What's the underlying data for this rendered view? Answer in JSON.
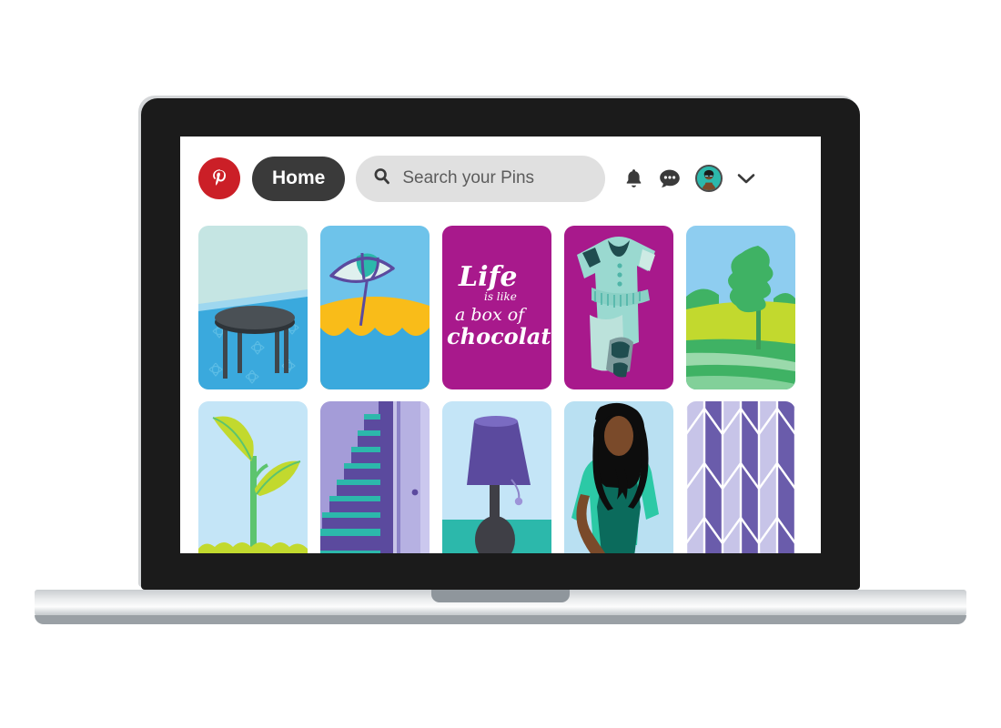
{
  "device": {
    "type": "laptop",
    "lid_color": "#1b1b1b",
    "base_color": "#d9dde0"
  },
  "app": {
    "name": "Pinterest",
    "brand_color": "#cb1f27"
  },
  "header": {
    "logo_icon": "pinterest-logo-icon",
    "home_label": "Home",
    "search": {
      "icon": "search-icon",
      "placeholder": "Search your Pins",
      "value": ""
    },
    "actions": [
      {
        "icon": "bell-icon",
        "label": "Notifications"
      },
      {
        "icon": "message-bubble-icon",
        "label": "Messages"
      },
      {
        "icon": "avatar-icon",
        "label": "Account"
      },
      {
        "icon": "chevron-down-icon",
        "label": "Account menu"
      }
    ]
  },
  "grid": {
    "pins": [
      {
        "id": "pin-1",
        "title": "Round dining table on blue patterned rug",
        "bg": "#3aa9dd"
      },
      {
        "id": "pin-2",
        "title": "Beach umbrella on sand by the sea",
        "bg": "#6ec3ea"
      },
      {
        "id": "pin-3",
        "title": "Life is like a box of chocolates quote",
        "bg": "#a8198c",
        "quote_lines": [
          "Life",
          "is like",
          "a box of",
          "chocolates"
        ]
      },
      {
        "id": "pin-4",
        "title": "Mint green baby romper dress",
        "bg": "#a8198c"
      },
      {
        "id": "pin-5",
        "title": "Tree in a green countryside field",
        "bg": "#8ecdf0"
      },
      {
        "id": "pin-6",
        "title": "Young green seedling sprout",
        "bg": "#c4e5f7"
      },
      {
        "id": "pin-7",
        "title": "Purple staircase beside a door",
        "bg": "#9a93d4"
      },
      {
        "id": "pin-8",
        "title": "Purple table lamp on teal surface",
        "bg": "#c4e5f7"
      },
      {
        "id": "pin-9",
        "title": "Woman in teal top with long hair",
        "bg": "#b9e0f2"
      },
      {
        "id": "pin-10",
        "title": "Purple herringbone chevron pattern",
        "bg": "#6a5cab"
      }
    ]
  },
  "palette": {
    "pinterest_red": "#cb1f27",
    "home_dark": "#3a3a3a",
    "search_grey": "#e0e0e0",
    "magenta": "#a8198c",
    "teal": "#2cb8ab",
    "purple": "#6a5cab",
    "lilac": "#c7c4e8",
    "sky": "#8ecdf0",
    "lime": "#c2d92e",
    "grass": "#3fb264",
    "sand": "#f9bc19",
    "sea": "#3aa9dd",
    "mint": "#9ad9d0"
  }
}
